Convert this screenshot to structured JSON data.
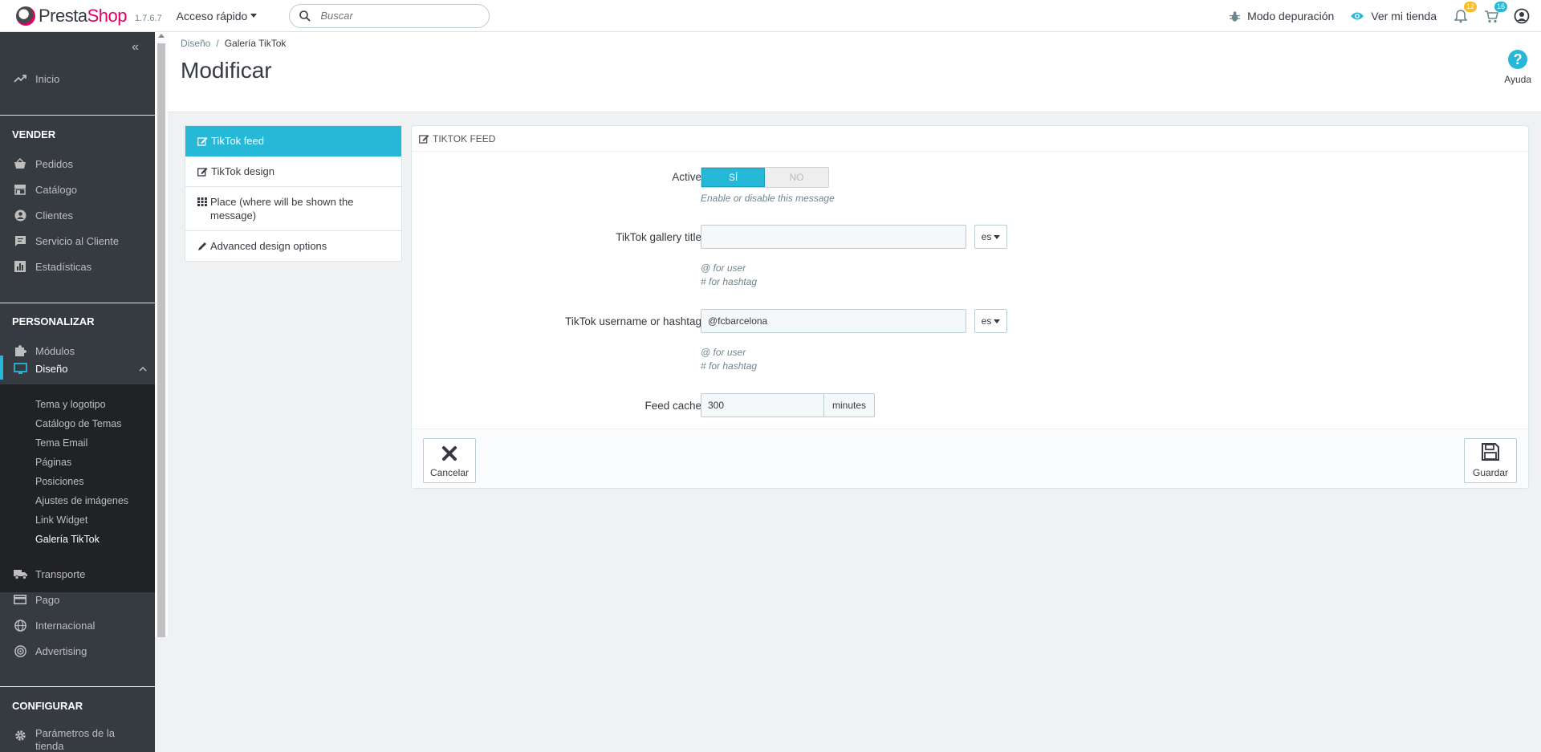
{
  "header": {
    "brand_prefix": "Presta",
    "brand_suffix": "Shop",
    "version": "1.7.6.7",
    "quick_access": "Acceso rápido",
    "search_placeholder": "Buscar",
    "debug_mode": "Modo depuración",
    "view_store": "Ver mi tienda",
    "notifications_count": "12",
    "orders_count": "16",
    "colors": {
      "brand_pink": "#df0067",
      "accent": "#25b9d7",
      "badge_orange": "#fbbb22"
    }
  },
  "sidebar": {
    "home": "Inicio",
    "sections": {
      "sell": "VENDER",
      "customize": "PERSONALIZAR",
      "configure": "CONFIGURAR"
    },
    "sell_items": [
      "Pedidos",
      "Catálogo",
      "Clientes",
      "Servicio al Cliente",
      "Estadísticas"
    ],
    "customize_items": [
      "Módulos",
      "Diseño"
    ],
    "design_subitems": [
      "Tema y logotipo",
      "Catálogo de Temas",
      "Tema Email",
      "Páginas",
      "Posiciones",
      "Ajustes de imágenes",
      "Link Widget",
      "Galería TikTok"
    ],
    "more_items": [
      "Transporte",
      "Pago",
      "Internacional",
      "Advertising"
    ],
    "configure_items": [
      "Parámetros de la tienda"
    ]
  },
  "page": {
    "breadcrumb": [
      "Diseño",
      "Galería TikTok"
    ],
    "breadcrumb_sep": "/",
    "title": "Modificar",
    "help": "Ayuda"
  },
  "tabs": [
    {
      "label": "TikTok feed",
      "icon": "edit-icon"
    },
    {
      "label": "TikTok design",
      "icon": "edit-icon"
    },
    {
      "label": "Place (where will be shown the message)",
      "icon": "grid-icon"
    },
    {
      "label": "Advanced design options",
      "icon": "pencil-icon"
    }
  ],
  "form": {
    "heading": "TIKTOK FEED",
    "active_label": "Active",
    "active_yes": "SÍ",
    "active_no": "NO",
    "active_help": "Enable or disable this message",
    "title_label": "TikTok gallery title",
    "title_value": "",
    "lang": "es",
    "help_user": "@ for user",
    "help_hashtag": "# for hashtag",
    "username_label": "TikTok username or hashtag",
    "username_value": "@fcbarcelona",
    "cache_label": "Feed cache",
    "cache_value": "300",
    "cache_unit": "minutes",
    "cancel": "Cancelar",
    "save": "Guardar"
  }
}
